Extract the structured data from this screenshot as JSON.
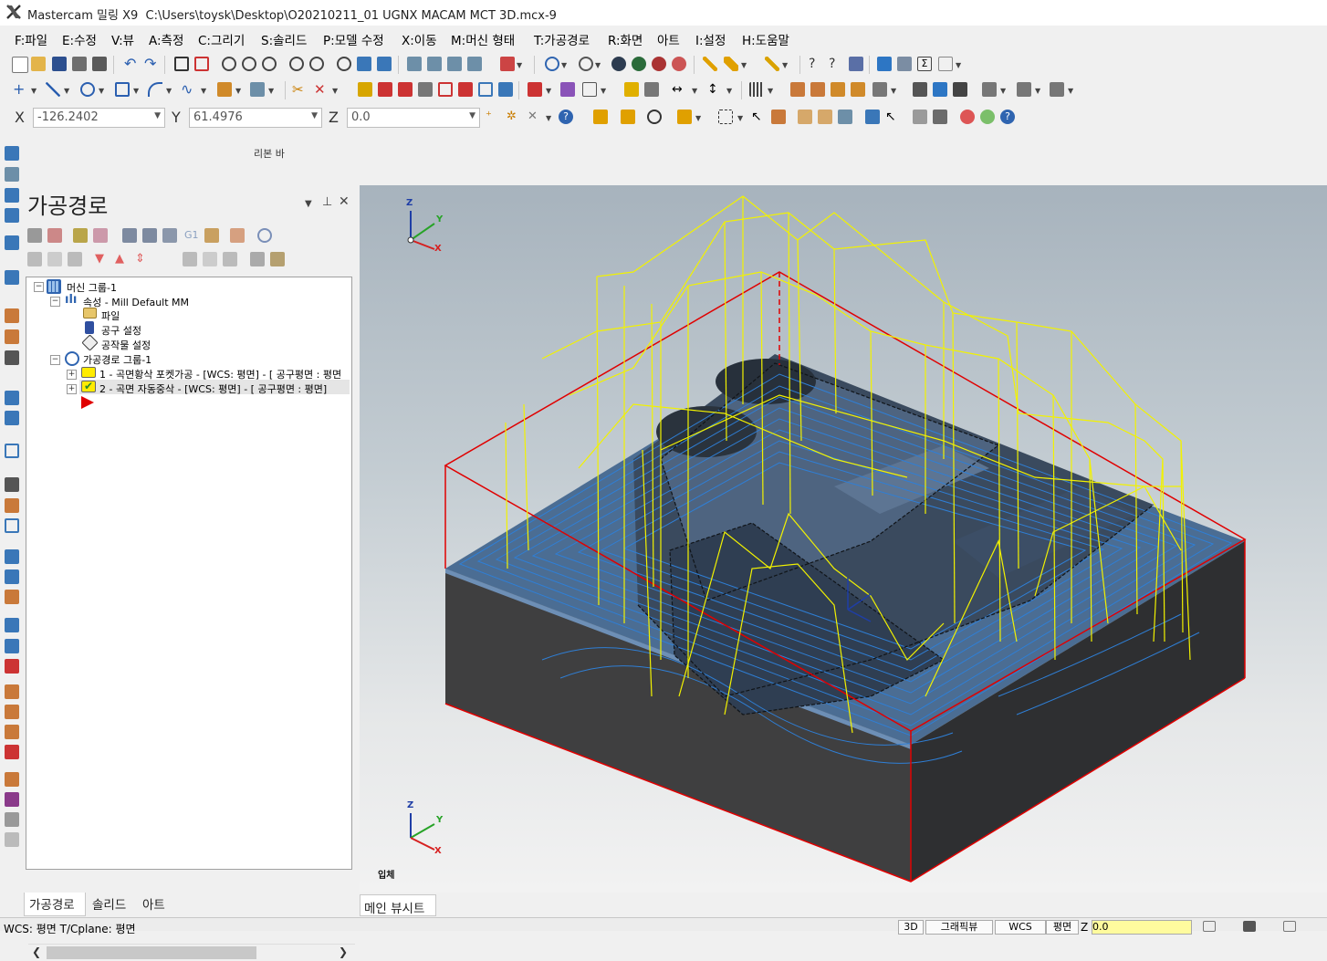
{
  "titlebar": {
    "app": "Mastercam 밀링 X9",
    "path": "C:\\Users\\toysk\\Desktop\\O20210211_01 UGNX MACAM MCT 3D.mcx-9"
  },
  "menu": [
    "F:파일",
    "E:수정",
    "V:뷰",
    "A:측정",
    "C:그리기",
    "S:솔리드",
    "P:모델 수정",
    "X:이동",
    "M:머신 형태",
    "T:가공경로",
    "R:화면",
    "아트",
    "I:설정",
    "H:도움말"
  ],
  "coords": {
    "x_label": "X",
    "x_value": "-126.2402",
    "y_label": "Y",
    "y_value": "61.4976",
    "z_label": "Z",
    "z_value": "0.0"
  },
  "ribbon_label": "리본 바",
  "panel": {
    "title": "가공경로",
    "tree": {
      "machine_group": "머신 그룹-1",
      "properties": "속성 - Mill Default MM",
      "files": "파일",
      "tool_settings": "공구 설정",
      "stock_setup": "공작물 설정",
      "toolpath_group": "가공경로 그룹-1",
      "op1": "1 - 곡면황삭 포켓가공 - [WCS: 평면] - [  공구평면 : 평면",
      "op2": "2 - 곡면 자동중삭 - [WCS: 평면] - [  공구평면 : 평면]"
    },
    "tabs": [
      "가공경로",
      "솔리드",
      "아트"
    ]
  },
  "viewport": {
    "tab": "메인 뷰시트",
    "view_label": "입체",
    "axes": {
      "z": "Z",
      "y": "Y",
      "x": "X"
    },
    "colors": {
      "toolpath_rapid": "#f2f200",
      "toolpath_cut": "#2f7fd6",
      "stock_box": "#e00000",
      "part_dark": "#3a3f46"
    }
  },
  "status": {
    "left": "WCS: 평면   T/Cplane: 평면",
    "mode": "3D",
    "gview": "그래픽뷰",
    "wcs": "WCS",
    "plane": "평면",
    "z_label": "Z",
    "z_value": "0.0"
  }
}
